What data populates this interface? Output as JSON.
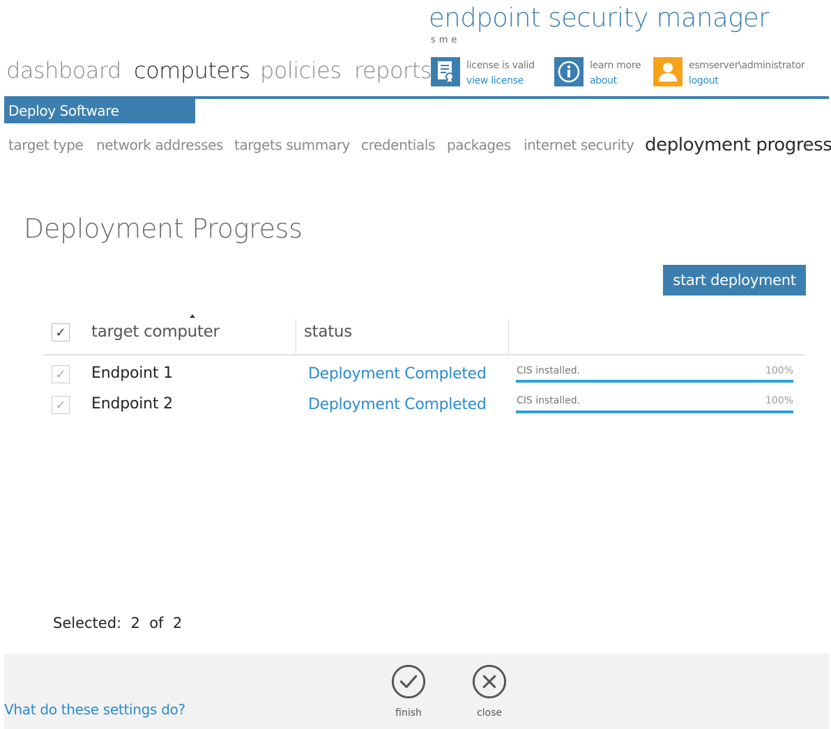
{
  "brand": {
    "title": "endpoint security manager",
    "subtitle": "sme"
  },
  "nav": [
    {
      "label": "dashboard",
      "active": false
    },
    {
      "label": "computers",
      "active": true
    },
    {
      "label": "policies",
      "active": false
    },
    {
      "label": "reports",
      "active": false
    }
  ],
  "header_links": {
    "license": {
      "line1": "license is valid",
      "line2": "view license",
      "icon": "certificate-icon"
    },
    "about": {
      "line1": "learn more",
      "line2": "about",
      "icon": "info-icon"
    },
    "user": {
      "line1": "esmserver\\administrator",
      "line2": "logout",
      "icon": "user-icon"
    }
  },
  "wizard": {
    "title": "Deploy Software",
    "steps": [
      "target type",
      "network addresses",
      "targets summary",
      "credentials",
      "packages",
      "internet security",
      "deployment progress"
    ],
    "active_step": "deployment progress"
  },
  "page_title": "Deployment Progress",
  "start_button": "start deployment",
  "table": {
    "columns": [
      "target computer",
      "status"
    ],
    "sort_column": "target computer",
    "header_checked": true,
    "rows": [
      {
        "checked": true,
        "name": "Endpoint 1",
        "status": "Deployment Completed",
        "progress_label": "CIS installed.",
        "progress_text": "100%",
        "progress": 100
      },
      {
        "checked": true,
        "name": "Endpoint 2",
        "status": "Deployment Completed",
        "progress_label": "CIS installed.",
        "progress_text": "100%",
        "progress": 100
      }
    ]
  },
  "selection": {
    "label": "Selected:",
    "count": "2",
    "of": "of",
    "total": "2"
  },
  "footer": {
    "help_link": "Vhat do these settings do?",
    "finish_label": "finish",
    "close_label": "close"
  },
  "colors": {
    "accent": "#3b7fb1",
    "link": "#2a8ccf",
    "progress": "#2a9fe0",
    "user_icon_bg": "#f7a21b"
  }
}
